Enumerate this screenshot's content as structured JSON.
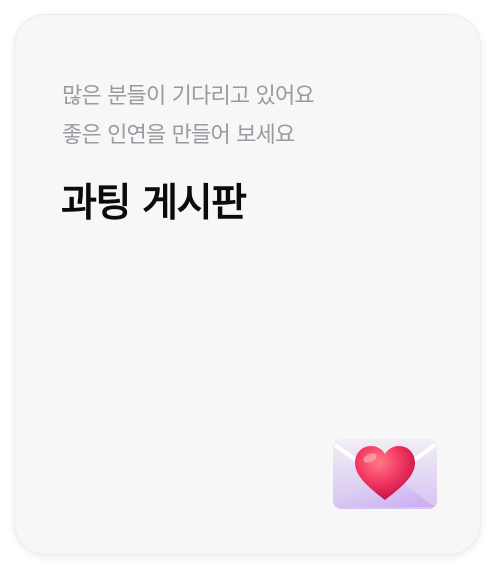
{
  "card": {
    "subtitle_line1": "많은 분들이 기다리고 있어요",
    "subtitle_line2": "좋은 인연을 만들어 보세요",
    "title": "과팅 게시판",
    "illustration_icon": "love-letter-icon",
    "colors": {
      "background": "#f7f7f8",
      "subtitle": "#9a9aa0",
      "title": "#0b0b0c",
      "heart": "#f43b63"
    }
  }
}
